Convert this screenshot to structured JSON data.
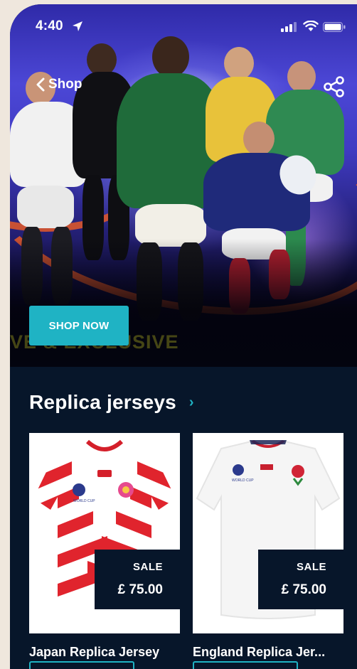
{
  "status_bar": {
    "time": "4:40",
    "icons": [
      "location-arrow-icon",
      "cellular-signal-icon",
      "wifi-icon",
      "battery-icon"
    ]
  },
  "nav": {
    "back_label": "Shop",
    "share_icon": "share-icon"
  },
  "hero": {
    "cta_label": "SHOP NOW",
    "partial_text": "VE & EXCLUSIVE"
  },
  "section": {
    "title": "Replica jerseys",
    "chevron": "›"
  },
  "products": [
    {
      "name": "Japan Replica Jersey",
      "badge": "SALE",
      "price": "£ 75.00"
    },
    {
      "name": "England Replica Jer...",
      "badge": "SALE",
      "price": "£ 75.00"
    }
  ],
  "colors": {
    "background": "#07162a",
    "accent": "#1fb3c4",
    "text": "#ffffff"
  }
}
